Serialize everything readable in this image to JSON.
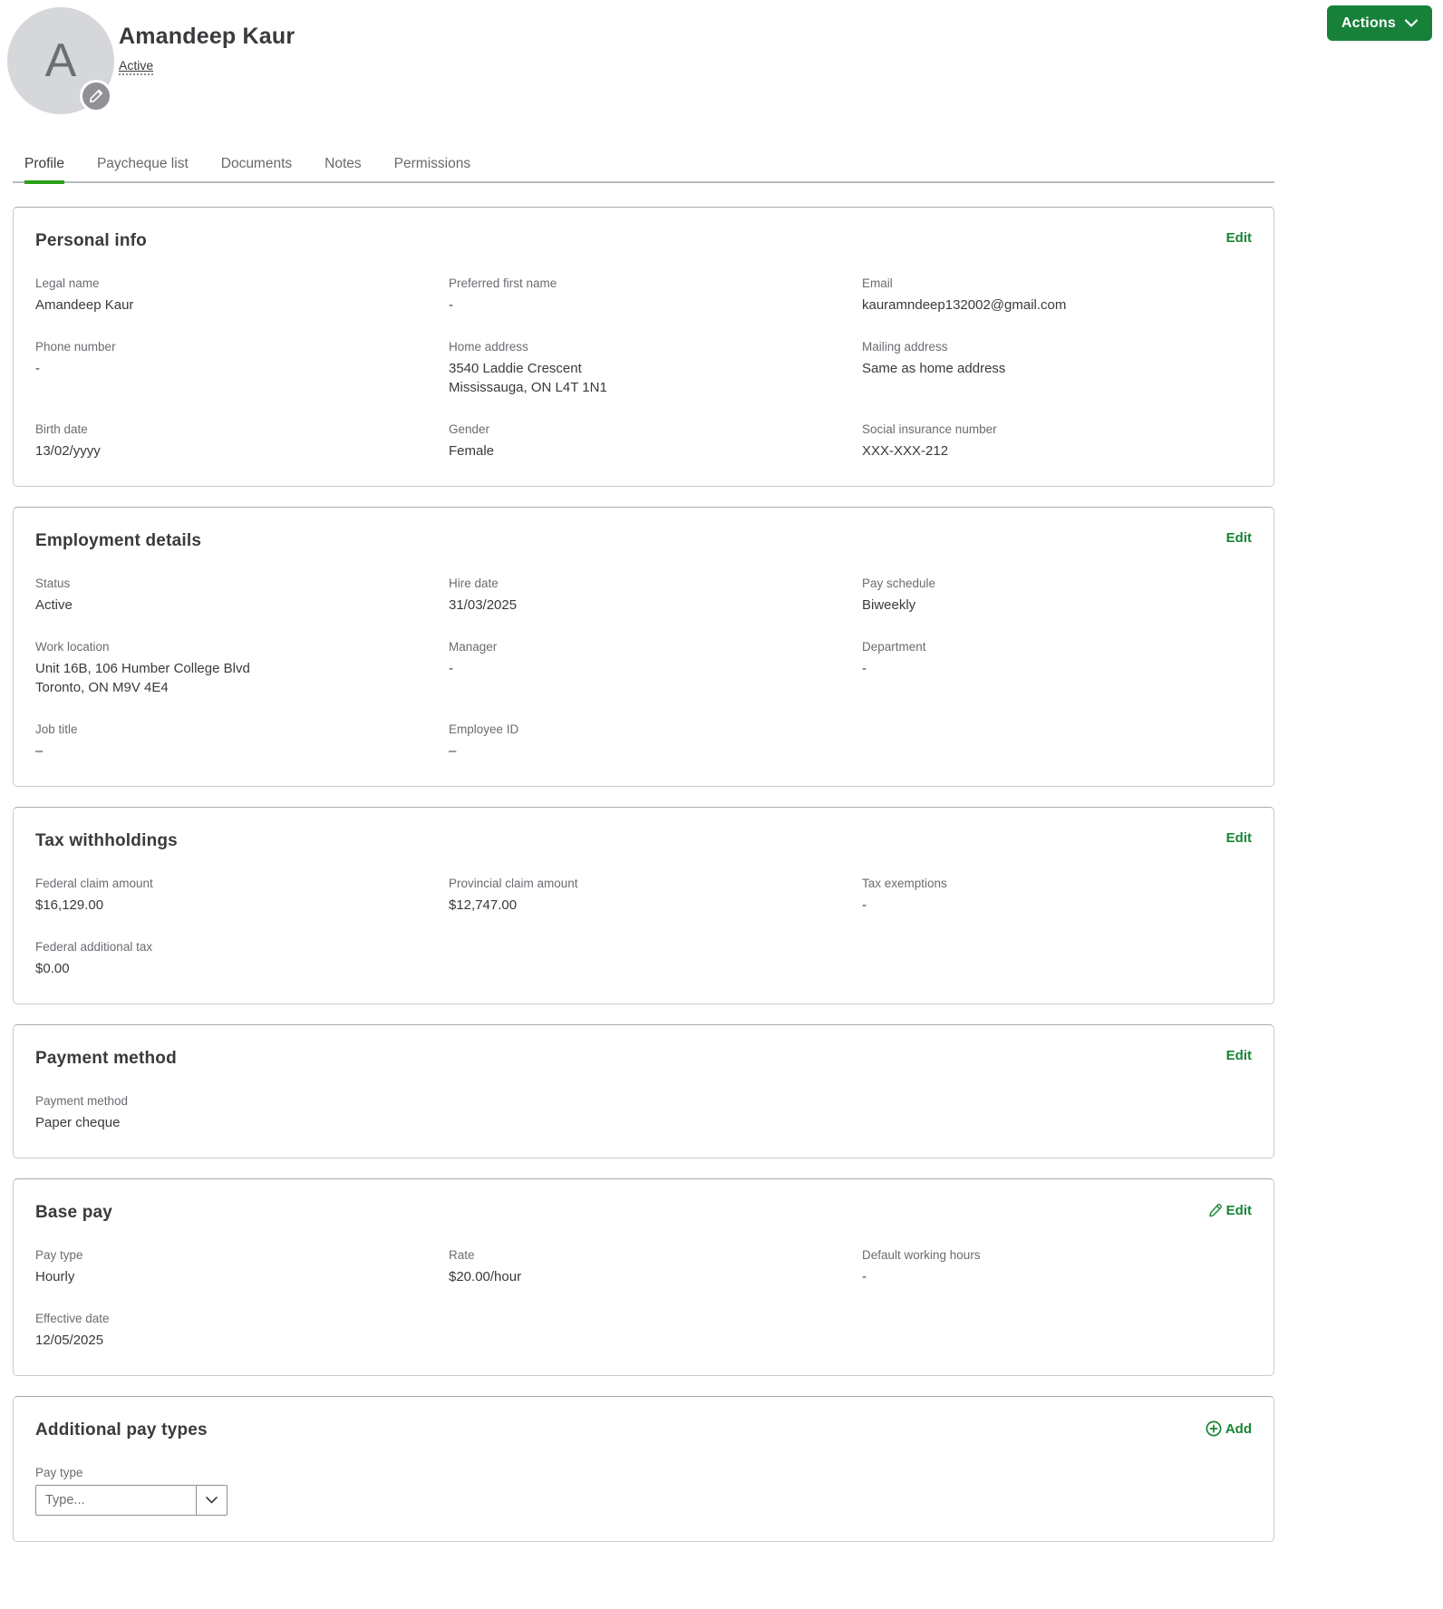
{
  "header": {
    "avatar_letter": "A",
    "name": "Amandeep Kaur",
    "status_label": "Active",
    "actions_label": "Actions"
  },
  "tabs": [
    {
      "label": "Profile",
      "active": true
    },
    {
      "label": "Paycheque list",
      "active": false
    },
    {
      "label": "Documents",
      "active": false
    },
    {
      "label": "Notes",
      "active": false
    },
    {
      "label": "Permissions",
      "active": false
    }
  ],
  "colors": {
    "accent_green": "#178535",
    "button_green": "#17813a",
    "tab_underline_green": "#2ca01c"
  },
  "sections": [
    {
      "id": "personal-info",
      "title": "Personal info",
      "action": {
        "label": "Edit",
        "icon": "none"
      },
      "fields": [
        {
          "label": "Legal name",
          "value": [
            "Amandeep Kaur"
          ]
        },
        {
          "label": "Preferred first name",
          "value": [
            "-"
          ]
        },
        {
          "label": "Email",
          "value": [
            "kauramndeep132002@gmail.com"
          ]
        },
        {
          "label": "Phone number",
          "value": [
            "-"
          ]
        },
        {
          "label": "Home address",
          "value": [
            "3540 Laddie Crescent",
            "Mississauga, ON L4T 1N1"
          ]
        },
        {
          "label": "Mailing address",
          "value": [
            "Same as home address"
          ]
        },
        {
          "label": "Birth date",
          "value": [
            "13/02/yyyy"
          ]
        },
        {
          "label": "Gender",
          "value": [
            "Female"
          ]
        },
        {
          "label": "Social insurance number",
          "value": [
            "XXX-XXX-212"
          ]
        }
      ]
    },
    {
      "id": "employment-details",
      "title": "Employment details",
      "action": {
        "label": "Edit",
        "icon": "none"
      },
      "fields": [
        {
          "label": "Status",
          "value": [
            "Active"
          ]
        },
        {
          "label": "Hire date",
          "value": [
            "31/03/2025"
          ]
        },
        {
          "label": "Pay schedule",
          "value": [
            "Biweekly"
          ]
        },
        {
          "label": "Work location",
          "value": [
            "Unit 16B, 106 Humber College Blvd",
            "Toronto, ON M9V 4E4"
          ]
        },
        {
          "label": "Manager",
          "value": [
            "-"
          ]
        },
        {
          "label": "Department",
          "value": [
            "-"
          ]
        },
        {
          "label": "Job title",
          "value": [
            "–"
          ]
        },
        {
          "label": "Employee ID",
          "value": [
            "–"
          ]
        }
      ]
    },
    {
      "id": "tax-withholdings",
      "title": "Tax withholdings",
      "action": {
        "label": "Edit",
        "icon": "none"
      },
      "fields": [
        {
          "label": "Federal claim amount",
          "value": [
            "$16,129.00"
          ]
        },
        {
          "label": "Provincial claim amount",
          "value": [
            "$12,747.00"
          ]
        },
        {
          "label": "Tax exemptions",
          "value": [
            "-"
          ]
        },
        {
          "label": "Federal additional tax",
          "value": [
            "$0.00"
          ]
        }
      ]
    },
    {
      "id": "payment-method",
      "title": "Payment method",
      "action": {
        "label": "Edit",
        "icon": "none"
      },
      "fields": [
        {
          "label": "Payment method",
          "value": [
            "Paper cheque"
          ]
        }
      ]
    },
    {
      "id": "base-pay",
      "title": "Base pay",
      "action": {
        "label": "Edit",
        "icon": "pencil"
      },
      "fields": [
        {
          "label": "Pay type",
          "value": [
            "Hourly"
          ]
        },
        {
          "label": "Rate",
          "value": [
            "$20.00/hour"
          ]
        },
        {
          "label": "Default working hours",
          "value": [
            "-"
          ]
        },
        {
          "label": "Effective date",
          "value": [
            "12/05/2025"
          ]
        }
      ]
    },
    {
      "id": "additional-pay-types",
      "title": "Additional pay types",
      "action": {
        "label": "Add",
        "icon": "plus-circle"
      },
      "fields": [],
      "form": {
        "field_label": "Pay type",
        "select_placeholder": "Type..."
      }
    }
  ]
}
